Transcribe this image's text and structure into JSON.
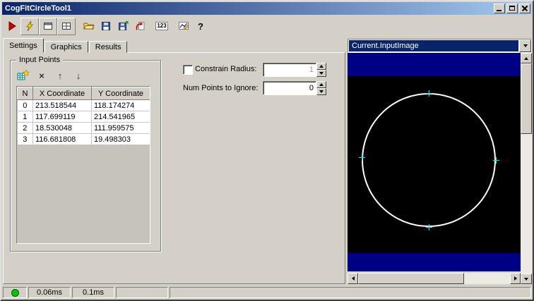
{
  "window": {
    "title": "CogFitCircleTool1"
  },
  "titlebar": {
    "buttons": [
      "minimize-button",
      "maximize-button",
      "close-button"
    ]
  },
  "toolbar": {
    "buttons": [
      {
        "name": "run",
        "icon": "run-icon"
      },
      {
        "name": "electric-run",
        "icon": "lightning-icon"
      },
      {
        "name": "show-image",
        "icon": "window-icon"
      },
      {
        "name": "show-grid",
        "icon": "grid-window-icon"
      },
      {
        "name": "open",
        "icon": "open-folder-icon"
      },
      {
        "name": "save",
        "icon": "floppy-icon"
      },
      {
        "name": "save-image",
        "icon": "floppy-plus-icon"
      },
      {
        "name": "reset",
        "icon": "reset-arrow-icon"
      },
      {
        "name": "show-values",
        "icon": "numbers-icon",
        "glyph": "123"
      },
      {
        "name": "chart",
        "icon": "chart-icon"
      },
      {
        "name": "help",
        "icon": "help-icon",
        "glyph": "?"
      }
    ]
  },
  "tabs": {
    "items": [
      {
        "label": "Settings",
        "active": true
      },
      {
        "label": "Graphics",
        "active": false
      },
      {
        "label": "Results",
        "active": false
      }
    ]
  },
  "input_points": {
    "title": "Input Points",
    "toolbar": [
      {
        "name": "add-point",
        "icon": "add-grid-icon"
      },
      {
        "name": "delete-point",
        "icon": "delete-x-icon",
        "glyph": "×"
      },
      {
        "name": "move-up",
        "icon": "arrow-up-icon",
        "glyph": "↑"
      },
      {
        "name": "move-down",
        "icon": "arrow-down-icon",
        "glyph": "↓"
      }
    ],
    "columns": [
      "N",
      "X Coordinate",
      "Y Coordinate"
    ],
    "rows": [
      {
        "n": "0",
        "x": "213.518544",
        "y": "118.174274"
      },
      {
        "n": "1",
        "x": "117.699119",
        "y": "214.541965"
      },
      {
        "n": "2",
        "x": "18.530048",
        "y": "111.959575"
      },
      {
        "n": "3",
        "x": "116.681808",
        "y": "19.498303"
      }
    ]
  },
  "params": {
    "constrain_radius_label": "Constrain Radius:",
    "constrain_radius_value": "1",
    "constrain_radius_checked": false,
    "num_points_label": "Num Points to Ignore:",
    "num_points_value": "0"
  },
  "image_panel": {
    "selected_image": "Current.InputImage"
  },
  "status": {
    "time1": "0.06ms",
    "time2": "0.1ms"
  },
  "colors": {
    "titlebar_start": "#0a246a",
    "titlebar_end": "#a6caf0",
    "face": "#d4d0c8",
    "highlight": "#0a246a",
    "image_band": "#000085",
    "circle": "#ffffff",
    "cross": "#00e8f0",
    "led": "#00c400"
  }
}
